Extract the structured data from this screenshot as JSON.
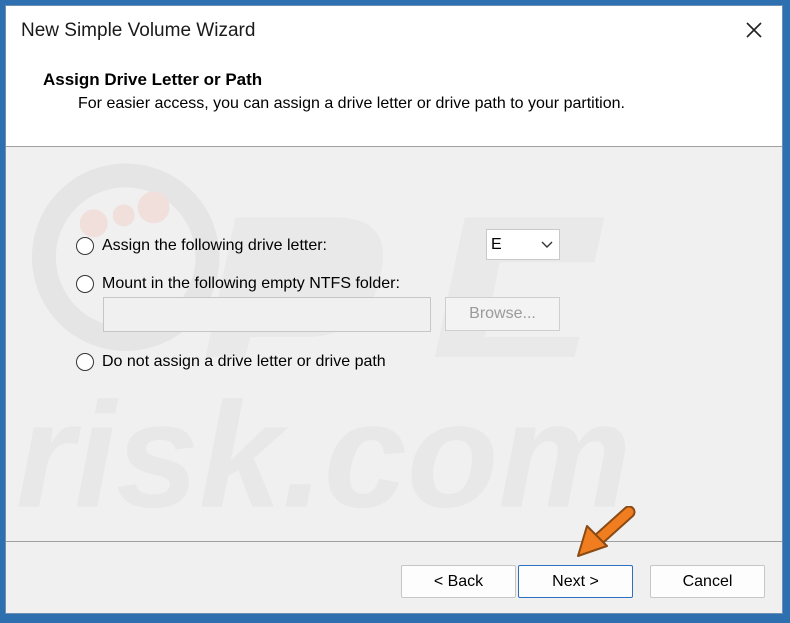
{
  "window": {
    "title": "New Simple Volume Wizard"
  },
  "header": {
    "title": "Assign Drive Letter or Path",
    "subtitle": "For easier access, you can assign a drive letter or drive path to your partition."
  },
  "options": [
    {
      "label": "Assign the following drive letter:",
      "checked": true
    },
    {
      "label": "Mount in the following empty NTFS folder:",
      "checked": false
    },
    {
      "label": "Do not assign a drive letter or drive path",
      "checked": false
    }
  ],
  "drive_letter": {
    "value": "E"
  },
  "folder_path": {
    "value": ""
  },
  "buttons": {
    "browse": "Browse...",
    "back": "< Back",
    "next": "Next >",
    "cancel": "Cancel"
  },
  "watermark": {
    "text": "risk.com",
    "logo": "PC"
  },
  "colors": {
    "accent": "#1a5fb4",
    "arrow": "#f07d1f",
    "desktop": "#2e6fb0"
  }
}
